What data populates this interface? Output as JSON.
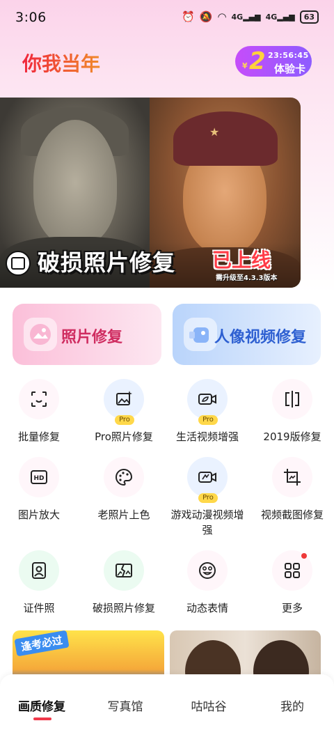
{
  "status_bar": {
    "time": "3:06",
    "signal_1": "4G",
    "signal_2": "4G",
    "battery": "63",
    "icons": [
      "alarm-icon",
      "mute-icon",
      "wifi-icon",
      "signal-icon",
      "signal-icon",
      "battery-icon"
    ]
  },
  "header": {
    "app_title": "你我当年",
    "trial_card": {
      "currency": "¥",
      "amount": "2",
      "countdown": "23:56:45",
      "label": "体验卡"
    }
  },
  "banner": {
    "title": "破损照片修复",
    "badge": "已上线",
    "note": "需升级至4.3.3版本"
  },
  "feature_cards": [
    {
      "label": "照片修复",
      "icon": "photo-icon"
    },
    {
      "label": "人像视频修复",
      "icon": "video-camera-icon"
    }
  ],
  "tools": [
    {
      "label": "批量修复",
      "icon": "batch-face-icon",
      "pro": false
    },
    {
      "label": "Pro照片修复",
      "icon": "image-sparkle-icon",
      "pro": true
    },
    {
      "label": "生活视频增强",
      "icon": "video-leaf-icon",
      "pro": true
    },
    {
      "label": "2019版修复",
      "icon": "split-frame-icon",
      "pro": false
    },
    {
      "label": "图片放大",
      "icon": "hd-icon",
      "pro": false
    },
    {
      "label": "老照片上色",
      "icon": "palette-icon",
      "pro": false
    },
    {
      "label": "游戏动漫视频增强",
      "icon": "game-video-icon",
      "pro": true
    },
    {
      "label": "视频截图修复",
      "icon": "crop-image-icon",
      "pro": false
    },
    {
      "label": "证件照",
      "icon": "id-photo-icon",
      "pro": false
    },
    {
      "label": "破损照片修复",
      "icon": "broken-photo-icon",
      "pro": false
    },
    {
      "label": "动态表情",
      "icon": "smile-icon",
      "pro": false
    },
    {
      "label": "更多",
      "icon": "grid-icon",
      "pro": false
    }
  ],
  "pro_label": "Pro",
  "promos": [
    {
      "tag": "逢考必过"
    },
    {
      "tag": ""
    }
  ],
  "bottom_nav": [
    {
      "label": "画质修复",
      "active": true
    },
    {
      "label": "写真馆",
      "active": false
    },
    {
      "label": "咕咕谷",
      "active": false
    },
    {
      "label": "我的",
      "active": false
    }
  ]
}
